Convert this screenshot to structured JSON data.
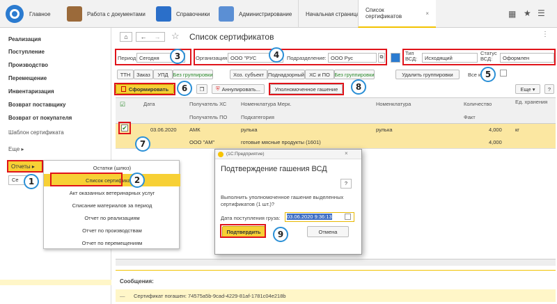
{
  "topbar": {
    "home": "Главное",
    "docs": "Работа с документами",
    "refs": "Справочники",
    "admin": "Администрирование",
    "tab_start": "Начальная страница",
    "tab_certs": "Список сертификатов"
  },
  "nav": {
    "items": [
      "Реализация",
      "Поступление",
      "Производство",
      "Перемещение",
      "Инвентаризация",
      "Возврат поставщику",
      "Возврат от покупателя"
    ],
    "template": "Шаблон сертификата",
    "more": "Еще",
    "reports": "Отчеты",
    "se": "Се"
  },
  "reports_menu": [
    "Остатки (шлюз)",
    "Список сертификатов",
    "Акт оказанных ветеринарных услуг",
    "Списание материалов за период",
    "Отчет по реализациям",
    "Отчет по производствам",
    "Отчет по перемещениям"
  ],
  "page": {
    "title": "Список сертификатов"
  },
  "filters": {
    "period_label": "Период:",
    "period_value": "Сегодня",
    "org_label": "Организация:",
    "org_value": "ООО \"РУС",
    "sub_label": "Подразделение:",
    "sub_value": "ООО Рус",
    "type_label": "Тип ВСД:",
    "type_value": "Исходящий",
    "status_label": "Статус ВСД:",
    "status_value": "Оформлен"
  },
  "groups": {
    "a": [
      "ТТН",
      "Заказ",
      "УПД",
      "Без группировки"
    ],
    "b": [
      "Хоз. субъект",
      "Поднадзорный",
      "ХС и ПО",
      "Без группировки"
    ],
    "remove": "Удалить группировки",
    "all": "Все к"
  },
  "actions": {
    "generate": "Сформировать",
    "annul": "Аннулировать...",
    "auth": "Уполномоченное гашение",
    "more": "Еще",
    "help": "?"
  },
  "table": {
    "headers": [
      "Дата",
      "Получатель ХС",
      "Номенклатура Мерк.",
      "Номенклатура",
      "Количество",
      "Ед. хранения"
    ],
    "subheaders": [
      "Получатель ПО",
      "Подкатегория",
      "Факт"
    ],
    "row": {
      "date": "03.06.2020",
      "recipient": "АМК",
      "merc": "рулька",
      "nom": "рулька",
      "qty": "4,000",
      "unit": "кг",
      "recipient_po": "ООО \"АМ\"",
      "subcat": "готовые мясные продукты (1601)",
      "fact": "4,000"
    }
  },
  "dialog": {
    "app": "(1С:Предприятие)",
    "title": "Подтверждение гашения ВСД",
    "text": "Выполнить уполномоченное гашение выделенных сертификатов (1 шт.)?",
    "date_label": "Дата поступления груза:",
    "date_value": "03.06.2020  9:36:13",
    "confirm": "Подтвердить",
    "cancel": "Отмена",
    "help": "?"
  },
  "messages": {
    "title": "Сообщения:",
    "text": "Сертификат погашен: 74575a5b-9cad-4229-81af-1781c04e218b"
  },
  "markers": [
    "1",
    "2",
    "3",
    "4",
    "5",
    "6",
    "7",
    "8",
    "9"
  ],
  "colors": {
    "accent_red": "#e0131a",
    "circle_blue": "#2a8fd6",
    "yellow": "#f7d035"
  }
}
